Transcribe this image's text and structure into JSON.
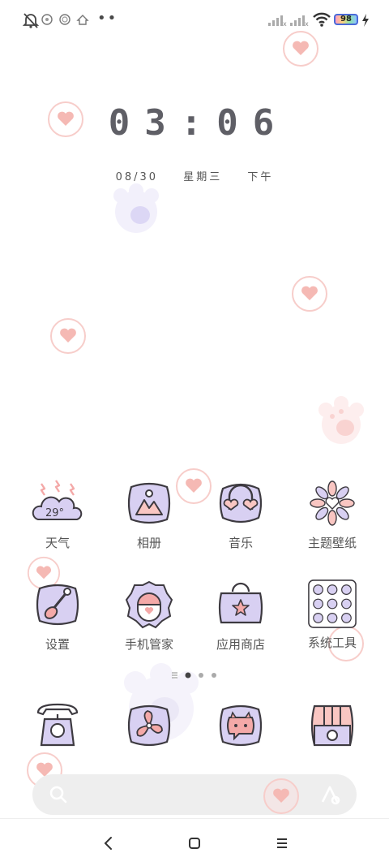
{
  "status": {
    "battery": "98",
    "icons": [
      "mute-bell-icon",
      "app-notification-icon",
      "app-notification-icon",
      "app-notification-icon",
      "more-dots-icon",
      "signal-icon",
      "signal-icon",
      "wifi-icon",
      "battery-icon",
      "charging-icon"
    ]
  },
  "clock": {
    "time": "03:06",
    "date": "08/30",
    "weekday": "星期三",
    "ampm": "下午"
  },
  "apps": [
    {
      "label": "天气",
      "temp": "29°",
      "icon": "weather-icon"
    },
    {
      "label": "相册",
      "icon": "gallery-icon"
    },
    {
      "label": "音乐",
      "icon": "music-icon"
    },
    {
      "label": "主题壁纸",
      "icon": "theme-flower-icon"
    },
    {
      "label": "设置",
      "icon": "settings-icon"
    },
    {
      "label": "手机管家",
      "icon": "security-icon"
    },
    {
      "label": "应用商店",
      "icon": "app-store-icon"
    },
    {
      "label": "系统工具",
      "icon": "folder-icon"
    }
  ],
  "dock": [
    "phone-icon",
    "fan-icon",
    "messages-icon",
    "camera-icon"
  ],
  "pager": {
    "pages": 3,
    "current": 1
  },
  "colors": {
    "accent_purple": "#d8d0f2",
    "accent_pink": "#f4a9a8",
    "outline": "#3d3a40",
    "heart": "#f9c6c2"
  }
}
